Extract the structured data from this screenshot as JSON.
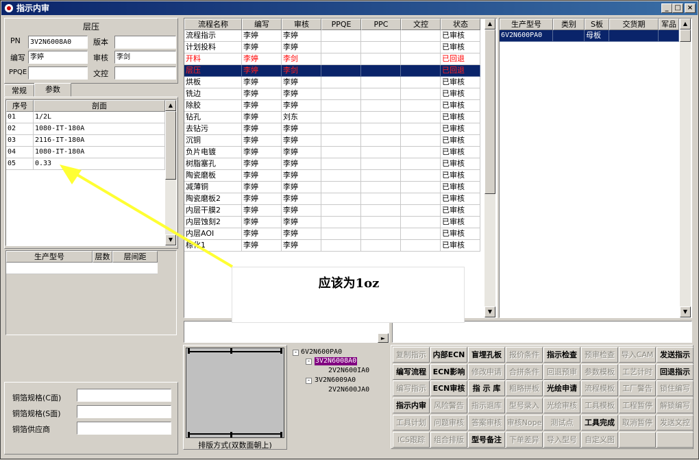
{
  "window": {
    "title": "指示内审",
    "min": "_",
    "max": "□",
    "close": "×"
  },
  "left": {
    "group_title": "层压",
    "pn_label": "PN",
    "pn_value": "3V2N6008A0",
    "version_label": "版本",
    "version_value": "",
    "writer_label": "编写",
    "writer_value": "李婷",
    "review_label": "审核",
    "review_value": "李剑",
    "ppqe_label": "PPQE",
    "ppqe_value": "",
    "wenkong_label": "文控",
    "wenkong_value": "",
    "tabs": [
      "常规",
      "参数"
    ],
    "section_grid": {
      "headers": [
        "序号",
        "剖面"
      ],
      "rows": [
        [
          "01",
          "1/2L"
        ],
        [
          "02",
          "1080-IT-180A"
        ],
        [
          "03",
          "2116-IT-180A"
        ],
        [
          "04",
          "1080-IT-180A"
        ],
        [
          "05",
          "0.33"
        ]
      ]
    },
    "model_grid": {
      "headers": [
        "生产型号",
        "层数",
        "层间距"
      ]
    },
    "copper_c_label": "铜箔规格(C面)",
    "copper_s_label": "铜箔规格(S面)",
    "copper_vendor_label": "铜箔供应商"
  },
  "flow_grid": {
    "headers": [
      "流程名称",
      "编写",
      "审核",
      "PPQE",
      "PPC",
      "文控",
      "状态"
    ],
    "rows": [
      {
        "cells": [
          "流程指示",
          "李婷",
          "李婷",
          "",
          "",
          "",
          "已审核"
        ],
        "style": "normal"
      },
      {
        "cells": [
          "计划投料",
          "李婷",
          "李婷",
          "",
          "",
          "",
          "已审核"
        ],
        "style": "normal"
      },
      {
        "cells": [
          "开料",
          "李婷",
          "李剑",
          "",
          "",
          "",
          "已回退"
        ],
        "style": "red"
      },
      {
        "cells": [
          "层压",
          "李婷",
          "李剑",
          "",
          "",
          "",
          "已回退"
        ],
        "style": "selected"
      },
      {
        "cells": [
          "烘板",
          "李婷",
          "李婷",
          "",
          "",
          "",
          "已审核"
        ],
        "style": "normal"
      },
      {
        "cells": [
          "铣边",
          "李婷",
          "李婷",
          "",
          "",
          "",
          "已审核"
        ],
        "style": "normal"
      },
      {
        "cells": [
          "除胶",
          "李婷",
          "李婷",
          "",
          "",
          "",
          "已审核"
        ],
        "style": "normal"
      },
      {
        "cells": [
          "钻孔",
          "李婷",
          "刘东",
          "",
          "",
          "",
          "已审核"
        ],
        "style": "normal"
      },
      {
        "cells": [
          "去钻污",
          "李婷",
          "李婷",
          "",
          "",
          "",
          "已审核"
        ],
        "style": "normal"
      },
      {
        "cells": [
          "沉铜",
          "李婷",
          "李婷",
          "",
          "",
          "",
          "已审核"
        ],
        "style": "normal"
      },
      {
        "cells": [
          "负片电镀",
          "李婷",
          "李婷",
          "",
          "",
          "",
          "已审核"
        ],
        "style": "normal"
      },
      {
        "cells": [
          "树脂塞孔",
          "李婷",
          "李婷",
          "",
          "",
          "",
          "已审核"
        ],
        "style": "normal"
      },
      {
        "cells": [
          "陶瓷磨板",
          "李婷",
          "李婷",
          "",
          "",
          "",
          "已审核"
        ],
        "style": "normal"
      },
      {
        "cells": [
          "减薄铜",
          "李婷",
          "李婷",
          "",
          "",
          "",
          "已审核"
        ],
        "style": "normal"
      },
      {
        "cells": [
          "陶瓷磨板2",
          "李婷",
          "李婷",
          "",
          "",
          "",
          "已审核"
        ],
        "style": "normal"
      },
      {
        "cells": [
          "内层干膜2",
          "李婷",
          "李婷",
          "",
          "",
          "",
          "已审核"
        ],
        "style": "normal"
      },
      {
        "cells": [
          "内层蚀刻2",
          "李婷",
          "李婷",
          "",
          "",
          "",
          "已审核"
        ],
        "style": "normal"
      },
      {
        "cells": [
          "内层AOI",
          "李婷",
          "李婷",
          "",
          "",
          "",
          "已审核"
        ],
        "style": "normal"
      },
      {
        "cells": [
          "棕化1",
          "李婷",
          "李婷",
          "",
          "",
          "",
          "已审核"
        ],
        "style": "normal"
      }
    ]
  },
  "right_grid": {
    "headers": [
      "生产型号",
      "类别",
      "S板",
      "交货期",
      "军品"
    ],
    "rows": [
      [
        "6V2N600PA0",
        "",
        "母板",
        "",
        ""
      ]
    ]
  },
  "annotation": {
    "text": "应该为1oz",
    "color": "#ff1a1a"
  },
  "preview_caption": "排版方式(双数面朝上)",
  "tree": {
    "root": "6V2N600PA0",
    "node1": "3V2N6008A0",
    "node1_child": "2V2N600IA0",
    "node2": "3V2N6009A0",
    "node2_child": "2V2N600JA0"
  },
  "buttons": [
    [
      "复制指示",
      "内部ECN",
      "盲埋孔板",
      "报价条件",
      "指示检查",
      "预审检查",
      "导入CAM",
      "发送指示"
    ],
    [
      "编写流程",
      "ECN影响",
      "修改申请",
      "合拼条件",
      "回退预审",
      "参数模板",
      "工艺计时",
      "回退指示"
    ],
    [
      "编写指示",
      "ECN审核",
      "指 示 库",
      "粗略拼板",
      "光绘申请",
      "流程模板",
      "工厂警告",
      "锁住编写"
    ],
    [
      "指示内审",
      "风险警告",
      "指示退库",
      "型号录入",
      "光绘审核",
      "工具模板",
      "工程暂停",
      "解锁编写"
    ],
    [
      "工具计划",
      "问题审核",
      "答案审核",
      "审核Nope",
      "测试点",
      "工具完成",
      "取消暂停",
      "发送文控"
    ],
    [
      "ICS跟踪",
      "组合排版",
      "型号备注",
      "下单差异",
      "导入型号",
      "自定义图",
      "",
      ""
    ]
  ],
  "button_enabled": [
    [
      0,
      1,
      1,
      0,
      1,
      0,
      0,
      1
    ],
    [
      1,
      1,
      0,
      0,
      0,
      0,
      0,
      1
    ],
    [
      0,
      1,
      1,
      0,
      1,
      0,
      0,
      0
    ],
    [
      1,
      0,
      0,
      0,
      0,
      0,
      0,
      0
    ],
    [
      0,
      0,
      0,
      0,
      0,
      1,
      0,
      0
    ],
    [
      0,
      0,
      1,
      0,
      0,
      0,
      0,
      0
    ]
  ]
}
